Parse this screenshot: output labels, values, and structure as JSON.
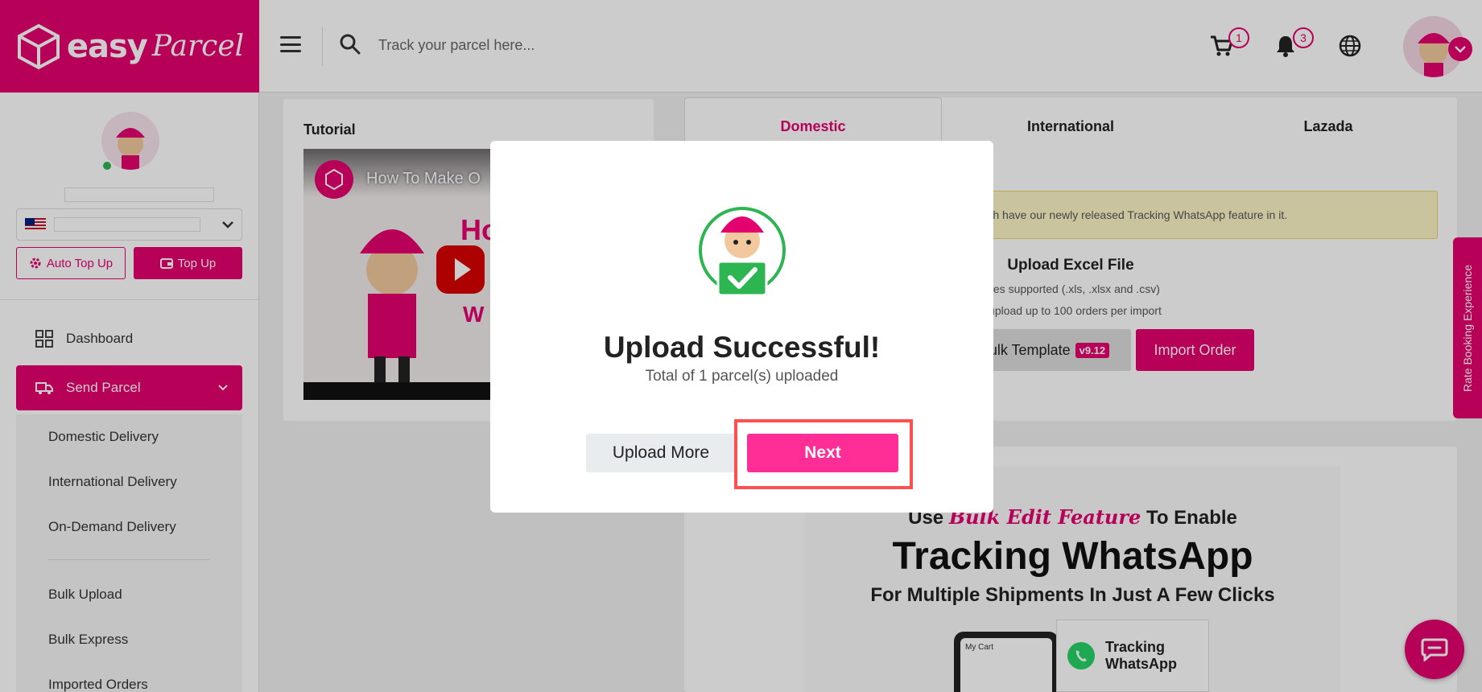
{
  "brand": {
    "easy": "easy",
    "parcel": "Parcel"
  },
  "header": {
    "search_placeholder": "Track your parcel here...",
    "cart_count": "1",
    "notification_count": "3"
  },
  "sidebar": {
    "auto_top_up": "Auto Top Up",
    "top_up": "Top Up",
    "nav": {
      "dashboard": "Dashboard",
      "send_parcel": "Send Parcel"
    },
    "sub_items": [
      "Domestic Delivery",
      "International Delivery",
      "On-Demand Delivery",
      "Bulk Upload",
      "Bulk Express",
      "Imported Orders"
    ]
  },
  "tutorial": {
    "title": "Tutorial",
    "video_title": "How To Make O",
    "video_text_right": "Ho",
    "video_text_right2": "W"
  },
  "tabs": [
    "Domestic",
    "International",
    "Lazada"
  ],
  "upload_panel": {
    "notice": "k template which have our newly released Tracking WhatsApp feature in it.",
    "title": "Upload Excel File",
    "files_supported": "Files supported (.xls, .xlsx and .csv)",
    "limit": "x upload up to 100 orders per import",
    "bulk_template": "Bulk Template",
    "template_version": "v9.12",
    "import_order": "Import Order"
  },
  "promo": {
    "use": "Use",
    "bulk_edit": "Bulk Edit Feature",
    "to_enable": "To Enable",
    "headline": "Tracking WhatsApp",
    "subline": "For Multiple Shipments In Just A Few Clicks",
    "phone_header": "My Cart",
    "wa_label_1": "Tracking",
    "wa_label_2": "WhatsApp"
  },
  "side_tab": "Rate Booking Experience",
  "modal": {
    "title": "Upload Successful!",
    "subtitle": "Total of 1 parcel(s) uploaded",
    "upload_more": "Upload More",
    "next": "Next"
  },
  "colors": {
    "brand": "#e5006f",
    "next_button": "#ff2d95",
    "highlight": "#ff5050"
  }
}
